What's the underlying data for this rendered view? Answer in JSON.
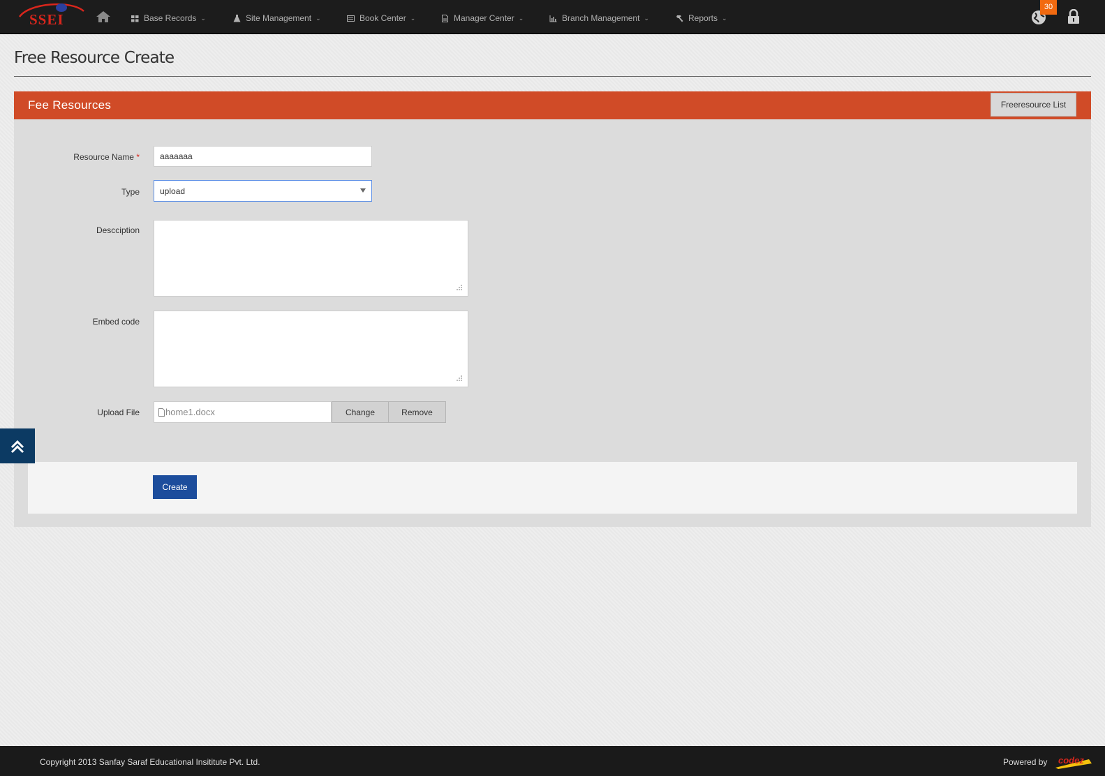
{
  "brand": {
    "logo_text": "SSEI"
  },
  "nav": {
    "items": [
      {
        "label": "Base Records"
      },
      {
        "label": "Site Management"
      },
      {
        "label": "Book Center"
      },
      {
        "label": "Manager Center"
      },
      {
        "label": "Branch Management"
      },
      {
        "label": "Reports"
      }
    ],
    "notification_count": "30"
  },
  "page": {
    "title": "Free Resource Create"
  },
  "panel": {
    "title": "Fee Resources",
    "list_button": "Freeresource List"
  },
  "form": {
    "resource_name": {
      "label": "Resource Name",
      "required_mark": "*",
      "value": "aaaaaaa"
    },
    "type": {
      "label": "Type",
      "value": "upload"
    },
    "description": {
      "label": "Descciption",
      "value": ""
    },
    "embed_code": {
      "label": "Embed code",
      "value": ""
    },
    "upload_file": {
      "label": "Upload File",
      "file_name": "home1.docx",
      "change_label": "Change",
      "remove_label": "Remove"
    },
    "create_label": "Create"
  },
  "footer": {
    "copyright": "Copyright 2013 Sanfay Saraf Educational Insititute Pvt. Ltd.",
    "powered_by": "Powered by",
    "powered_logo": "codez"
  },
  "colors": {
    "accent": "#d04b27",
    "topbar": "#1c1c1c",
    "primary_button": "#1c4d9c",
    "badge": "#f26a10"
  }
}
